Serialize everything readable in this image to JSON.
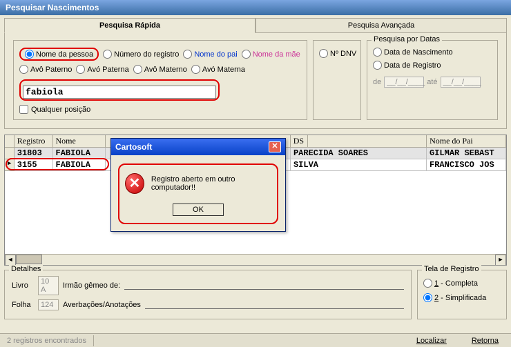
{
  "window": {
    "title": "Pesquisar Nascimentos"
  },
  "tabs": {
    "quick": "Pesquisa Rápida",
    "advanced": "Pesquisa Avançada"
  },
  "search": {
    "options": {
      "nome_pessoa": "Nome da pessoa",
      "numero_registro": "Número do registro",
      "nome_pai": "Nome do pai",
      "nome_mae": "Nome da mãe",
      "avo_paterno": "Avô Paterno",
      "avo_paterna": "Avó Paterna",
      "avo_materno": "Avô Materno",
      "avo_materna": "Avó Materna"
    },
    "input_value": "fabiola",
    "qualquer_posicao": "Qualquer posição",
    "n_dnv": "Nº DNV",
    "por_datas": {
      "legend": "Pesquisa por Datas",
      "data_nascimento": "Data de Nascimento",
      "data_registro": "Data de Registro",
      "de": "de",
      "ate": "até",
      "placeholder": "__/__/____"
    }
  },
  "grid": {
    "headers": {
      "registro": "Registro",
      "nome": "Nome",
      "mae_suffix": "DS",
      "nome_pai": "Nome do Pai"
    },
    "rows": [
      {
        "marker": "",
        "registro": "31803",
        "nome": "FABIOLA",
        "mae": "PARECIDA SOARES",
        "pai": "GILMAR SEBAST"
      },
      {
        "marker": "▶",
        "registro": "3155",
        "nome": "FABIOLA",
        "mae": "SILVA",
        "pai": "FRANCISCO JOS"
      }
    ]
  },
  "details": {
    "legend": "Detalhes",
    "livro_label": "Livro",
    "livro_value": "10 A",
    "folha_label": "Folha",
    "folha_value": "124",
    "irmao_gemeo": "Irmão gêmeo de:",
    "averbacoes": "Averbações/Anotações"
  },
  "tela": {
    "legend": "Tela de Registro",
    "completa": "1 - Completa",
    "simplificada": "2 - Simplificada"
  },
  "statusbar": {
    "count": "2 registros encontrados",
    "localizar": "Localizar",
    "retorna": "Retorna"
  },
  "dialog": {
    "title": "Cartosoft",
    "message": "Registro aberto em outro computador!!",
    "ok": "OK"
  }
}
